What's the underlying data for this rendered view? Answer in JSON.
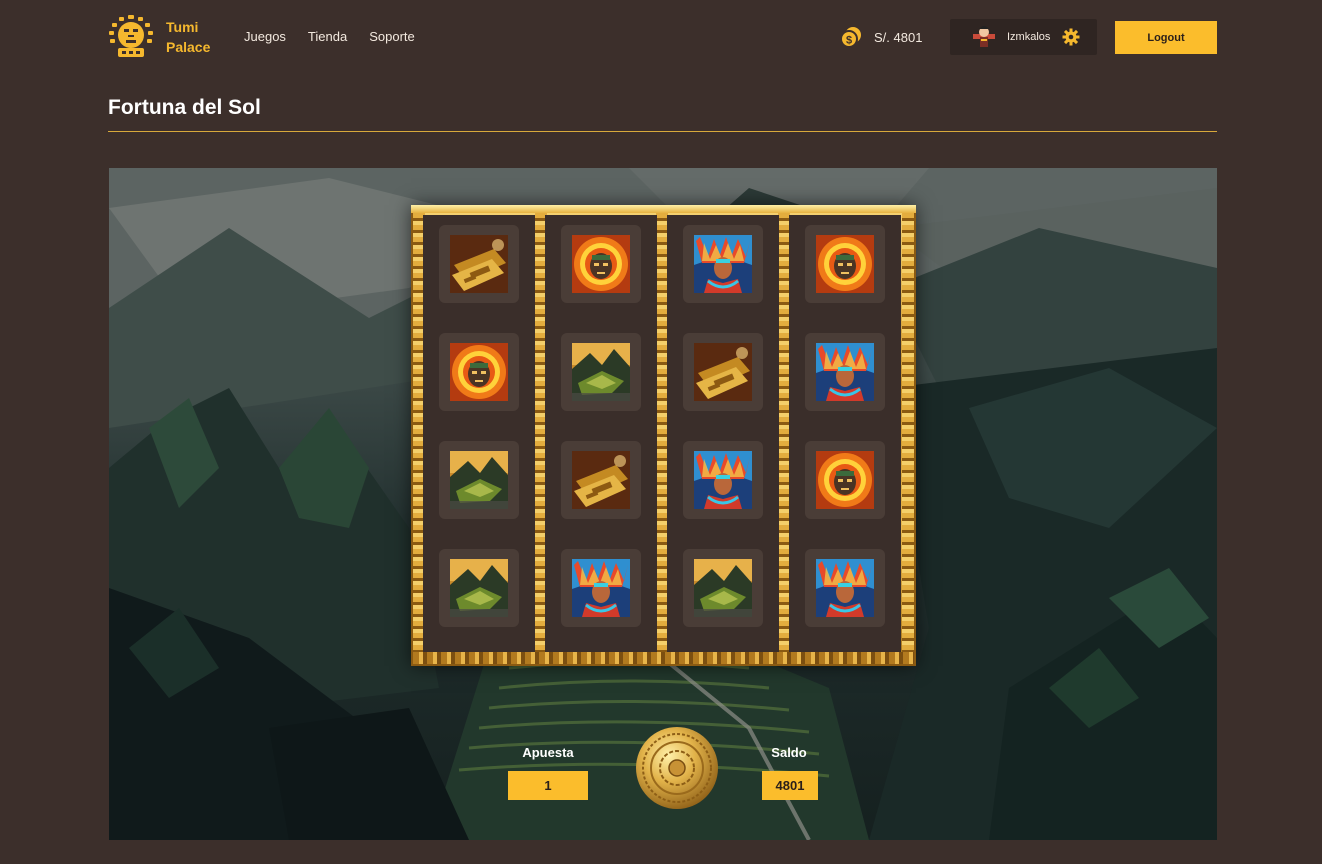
{
  "brand": {
    "line1": "Tumi",
    "line2": "Palace"
  },
  "nav": [
    {
      "label": "Juegos"
    },
    {
      "label": "Tienda"
    },
    {
      "label": "Soporte"
    }
  ],
  "wallet": {
    "balance_text": "S/. 4801"
  },
  "user": {
    "name": "Izmkalos"
  },
  "logout_label": "Logout",
  "page": {
    "title": "Fortuna del Sol"
  },
  "reels": [
    [
      "gold-tablet",
      "sun-mask",
      "machu-picchu",
      "machu-picchu"
    ],
    [
      "sun-mask",
      "machu-picchu",
      "gold-tablet",
      "inca-warrior"
    ],
    [
      "inca-warrior",
      "gold-tablet",
      "inca-warrior",
      "machu-picchu"
    ],
    [
      "sun-mask",
      "inca-warrior",
      "sun-mask",
      "inca-warrior"
    ]
  ],
  "controls": {
    "bet_label": "Apuesta",
    "bet_value": "1",
    "balance_label": "Saldo",
    "balance_value": "4801"
  },
  "colors": {
    "accent": "#fbbd2c",
    "background": "#3c2f2b",
    "gold": "#d8a93b"
  }
}
